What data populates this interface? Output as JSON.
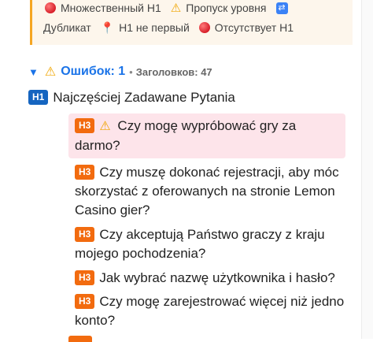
{
  "legend": {
    "row1": [
      {
        "icon": "red-dot-icon",
        "label": "Множественный H1"
      },
      {
        "icon": "warning-icon",
        "label": "Пропуск уровня"
      },
      {
        "icon": "duplicate-icon",
        "label": ""
      }
    ],
    "row2": [
      {
        "icon": "",
        "label": "Дубликат"
      },
      {
        "icon": "pin-icon",
        "label": "H1 не первый"
      },
      {
        "icon": "red-dot-icon",
        "label": "Отсутствует H1"
      }
    ]
  },
  "summary": {
    "errors_label": "Ошибок: 1",
    "separator": "•",
    "headings_label": "Заголовков: 47"
  },
  "headings": {
    "h1": {
      "level": "H1",
      "text": "Najczęściej Zadawane Pytania"
    },
    "items": [
      {
        "level": "H3",
        "text": "Czy mogę wypróbować gry za darmo?",
        "error": true
      },
      {
        "level": "H3",
        "text": "Czy muszę dokonać rejestracji, aby móc skorzystać z oferowanych na stronie Lemon Casino gier?",
        "error": false
      },
      {
        "level": "H3",
        "text": "Czy akceptują Państwo graczy z kraju mojego pochodzenia?",
        "error": false
      },
      {
        "level": "H3",
        "text": "Jak wybrać nazwę użytkownika i hasło?",
        "error": false
      },
      {
        "level": "H3",
        "text": "Czy mogę zarejestrować więcej niż jedno konto?",
        "error": false
      }
    ]
  },
  "colors": {
    "h1_badge": "#1565c0",
    "h3_badge": "#f26b0f",
    "error_bg": "#fde4ea",
    "accent": "#1a73e8",
    "warning": "#f0a500"
  }
}
